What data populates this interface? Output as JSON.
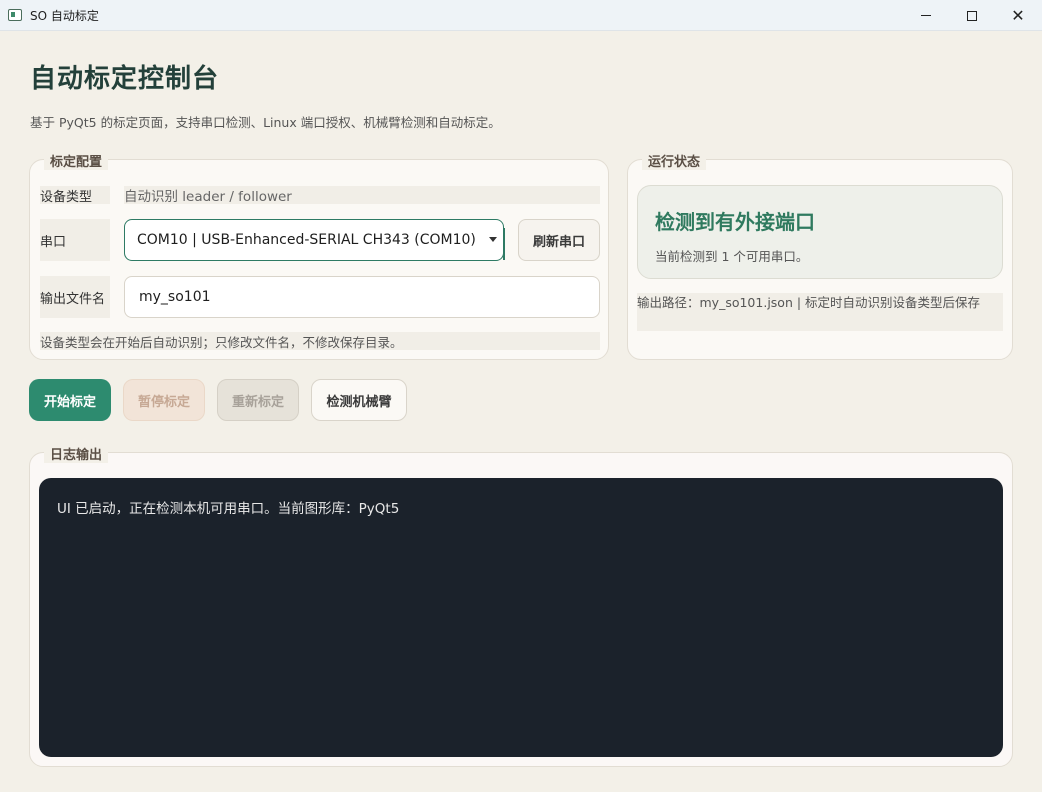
{
  "window": {
    "title": "SO 自动标定"
  },
  "header": {
    "title": "自动标定控制台",
    "subtitle": "基于 PyQt5 的标定页面，支持串口检测、Linux 端口授权、机械臂检测和自动标定。"
  },
  "config": {
    "group_title": "标定配置",
    "device_type_label": "设备类型",
    "device_type_value": "自动识别 leader / follower",
    "port_label": "串口",
    "port_value": "COM10  |  USB-Enhanced-SERIAL CH343 (COM10)",
    "refresh_label": "刷新串口",
    "file_label": "输出文件名",
    "file_value": "my_so101",
    "hint": "设备类型会在开始后自动识别；只修改文件名，不修改保存目录。"
  },
  "status": {
    "group_title": "运行状态",
    "headline": "检测到有外接端口",
    "detail": "当前检测到 1 个可用串口。",
    "output_path": "输出路径：my_so101.json | 标定时自动识别设备类型后保存"
  },
  "actions": {
    "start": "开始标定",
    "pause": "暂停标定",
    "restart": "重新标定",
    "detect": "检测机械臂"
  },
  "logs": {
    "group_title": "日志输出",
    "lines": [
      "UI 已启动，正在检测本机可用串口。当前图形库：PyQt5"
    ]
  },
  "colors": {
    "accent": "#2d8b6f",
    "background": "#f3f0e8",
    "log_background": "#1b222b"
  }
}
